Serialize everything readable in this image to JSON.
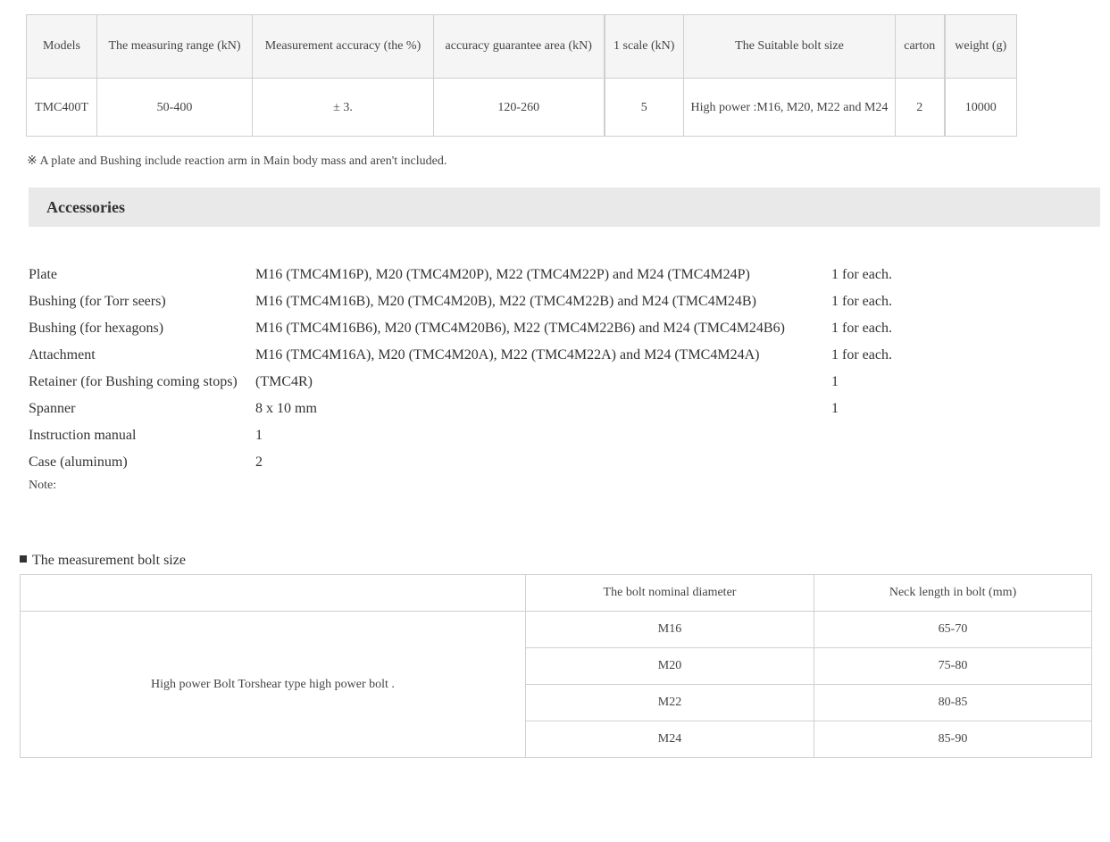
{
  "spec_table": {
    "headers": [
      "Models",
      "The measuring range (kN)",
      "Measurement accuracy (the %)",
      "accuracy guarantee area (kN)",
      "1 scale (kN)",
      "The Suitable bolt size",
      "carton",
      "weight (g)"
    ],
    "row": [
      "TMC400T",
      "50-400",
      "± 3.",
      "120-260",
      "5",
      "High power :M16, M20, M22 and M24",
      "2",
      "10000"
    ]
  },
  "mass_note": "※ A plate and Bushing include reaction arm in Main body mass and aren't included.",
  "accessories": {
    "title": "Accessories",
    "items": [
      {
        "name": "Plate",
        "spec": "M16 (TMC4M16P), M20 (TMC4M20P), M22 (TMC4M22P) and M24 (TMC4M24P)",
        "qty": "1 for each."
      },
      {
        "name": "Bushing (for Torr seers)",
        "spec": "M16 (TMC4M16B), M20 (TMC4M20B), M22 (TMC4M22B) and M24 (TMC4M24B)",
        "qty": "1 for each."
      },
      {
        "name": "Bushing (for hexagons)",
        "spec": "M16 (TMC4M16B6), M20 (TMC4M20B6), M22 (TMC4M22B6) and M24 (TMC4M24B6)",
        "qty": "1 for each."
      },
      {
        "name": "Attachment",
        "spec": "M16 (TMC4M16A), M20 (TMC4M20A), M22 (TMC4M22A) and M24 (TMC4M24A)",
        "qty": "1 for each."
      },
      {
        "name": "Retainer (for Bushing coming stops)",
        "spec": "(TMC4R)",
        "qty": "1"
      },
      {
        "name": "Spanner",
        "spec": "8 x 10 mm",
        "qty": "1"
      },
      {
        "name": "Instruction manual",
        "spec": "1",
        "qty": ""
      },
      {
        "name": "Case (aluminum)",
        "spec": "2",
        "qty": ""
      }
    ],
    "note": "Note:"
  },
  "bolt_section": {
    "heading": "The measurement bolt size",
    "headers": [
      "",
      "The bolt nominal diameter",
      "Neck length in bolt (mm)"
    ],
    "type_label": "High power Bolt Torshear type high power bolt .",
    "rows": [
      {
        "diameter": "M16",
        "neck": "65-70"
      },
      {
        "diameter": "M20",
        "neck": "75-80"
      },
      {
        "diameter": "M22",
        "neck": "80-85"
      },
      {
        "diameter": "M24",
        "neck": "85-90"
      }
    ]
  }
}
